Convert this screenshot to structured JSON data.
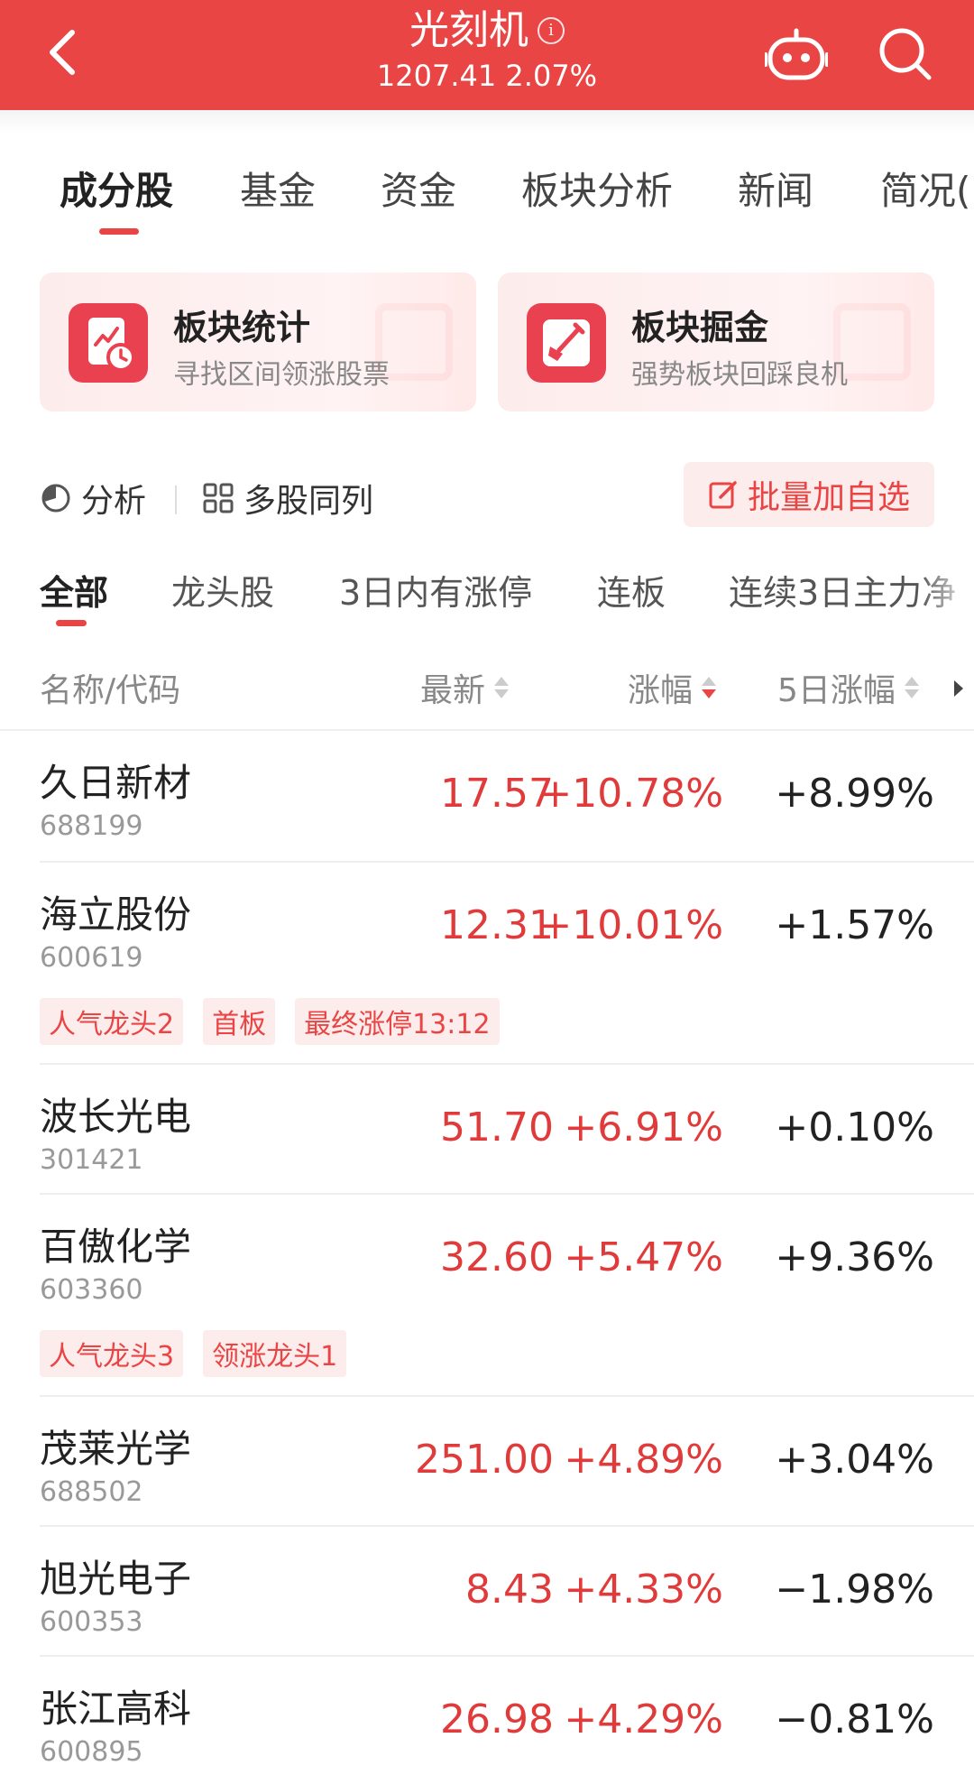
{
  "header": {
    "title": "光刻机",
    "index_value": "1207.41",
    "index_change": "2.07%",
    "colors": {
      "bg": "#e94545",
      "text": "#ffffff"
    },
    "icons": [
      "back-icon",
      "info-icon",
      "robot-icon",
      "search-icon"
    ]
  },
  "main_tabs": [
    "成分股",
    "基金",
    "资金",
    "板块分析",
    "新闻",
    "简况("
  ],
  "main_tab_active": "成分股",
  "cards": [
    {
      "title": "板块统计",
      "subtitle": "寻找区间领涨股票",
      "icon": "chart-clock-icon"
    },
    {
      "title": "板块掘金",
      "subtitle": "强势板块回踩良机",
      "icon": "shovel-icon"
    }
  ],
  "tools": {
    "analysis": "分析",
    "multi": "多股同列",
    "batch_add": "批量加自选"
  },
  "filter_tabs": [
    "全部",
    "龙头股",
    "3日内有涨停",
    "连板",
    "连续3日主力净"
  ],
  "filter_active": "全部",
  "columns": {
    "name": "名称/代码",
    "latest": "最新",
    "change": "涨幅",
    "five_day": "5日涨幅"
  },
  "sort": {
    "column": "涨幅",
    "direction": "desc"
  },
  "stocks": [
    {
      "name": "久日新材",
      "code": "688199",
      "latest": "17.57",
      "change": "+10.78%",
      "five_day": "+8.99%",
      "tags": []
    },
    {
      "name": "海立股份",
      "code": "600619",
      "latest": "12.31",
      "change": "+10.01%",
      "five_day": "+1.57%",
      "tags": [
        "人气龙头2",
        "首板",
        "最终涨停13:12"
      ]
    },
    {
      "name": "波长光电",
      "code": "301421",
      "latest": "51.70",
      "change": "+6.91%",
      "five_day": "+0.10%",
      "tags": []
    },
    {
      "name": "百傲化学",
      "code": "603360",
      "latest": "32.60",
      "change": "+5.47%",
      "five_day": "+9.36%",
      "tags": [
        "人气龙头3",
        "领涨龙头1"
      ]
    },
    {
      "name": "茂莱光学",
      "code": "688502",
      "latest": "251.00",
      "change": "+4.89%",
      "five_day": "+3.04%",
      "tags": []
    },
    {
      "name": "旭光电子",
      "code": "600353",
      "latest": "8.43",
      "change": "+4.33%",
      "five_day": "−1.98%",
      "tags": []
    },
    {
      "name": "张江高科",
      "code": "600895",
      "latest": "26.98",
      "change": "+4.29%",
      "five_day": "−0.81%",
      "tags": []
    }
  ],
  "colors": {
    "up": "#e03a3a",
    "accent": "#e94545",
    "tag_bg": "#fdecec"
  }
}
